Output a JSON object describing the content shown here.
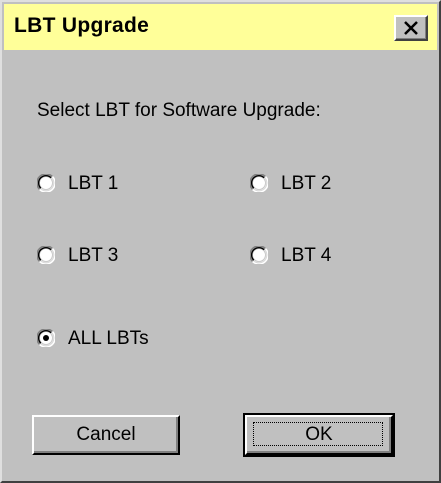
{
  "dialog": {
    "title": "LBT Upgrade",
    "title_bar_color": "#ffff99",
    "close_icon": "close-x-icon",
    "prompt": "Select LBT for  Software Upgrade:"
  },
  "options": [
    {
      "label": "LBT 1",
      "selected": false
    },
    {
      "label": "LBT 2",
      "selected": false
    },
    {
      "label": "LBT 3",
      "selected": false
    },
    {
      "label": "LBT 4",
      "selected": false
    },
    {
      "label": "ALL LBTs",
      "selected": true
    }
  ],
  "buttons": {
    "cancel_label": "Cancel",
    "ok_label": "OK"
  }
}
